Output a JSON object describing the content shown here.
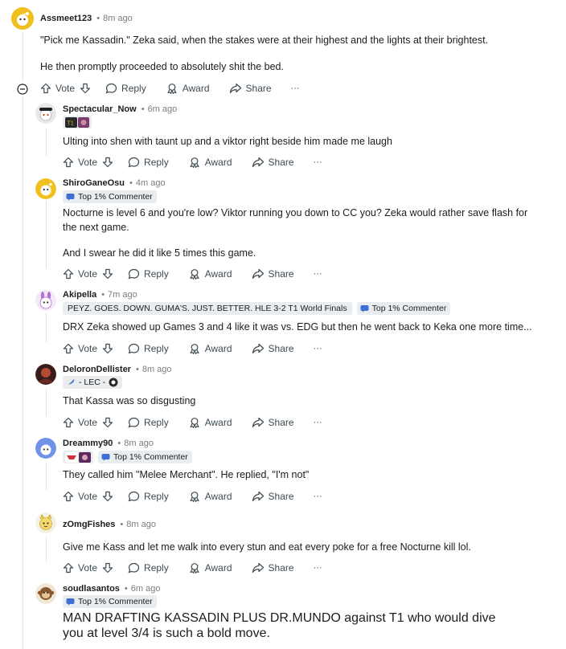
{
  "actions": {
    "vote": "Vote",
    "reply": "Reply",
    "award": "Award",
    "share": "Share",
    "more": "···"
  },
  "colors": {
    "accent_yellow": "#f2c01e",
    "text": "#1c1c1c",
    "muted": "#7c7c7c",
    "flair_bg": "#eaedef"
  },
  "comments": [
    {
      "author": "Assmeet123",
      "time": "8m ago",
      "avatar": "snoo-yellow",
      "paragraphs": [
        "\"Pick me Kassadin.\" Zeka said, when the stakes were at their highest and the lights at their brightest.",
        "He then promptly proceeded to absolutely shit the bed."
      ]
    },
    {
      "author": "Spectacular_Now",
      "time": "6m ago",
      "avatar": "snoo-dark",
      "flair_icons": [
        "team-logo-icon",
        "champion-icon"
      ],
      "paragraphs": [
        "Ulting into shen with taunt up and a viktor right beside him made me laugh"
      ]
    },
    {
      "author": "ShiroGaneOsu",
      "time": "4m ago",
      "avatar": "snoo-yellow",
      "flair": "Top 1% Commenter",
      "paragraphs": [
        "Nocturne is level 6 and you're low? Viktor running you down to CC you? Zeka would rather save flash for",
        "the next game.",
        "And I swear he did it like 5 times this game."
      ]
    },
    {
      "author": "Akipella",
      "time": "7m ago",
      "avatar": "snoo-purple",
      "flair_long": "PEYZ. GOES. DOWN. GUMA'S. JUST. BETTER. HLE 3-2 T1 World Finals",
      "flair": "Top 1% Commenter",
      "paragraphs": [
        "DRX Zeka showed up Games 3 and 4 like it was vs. EDG but then he went back to Keka one more time..."
      ]
    },
    {
      "author": "DeloronDellister",
      "time": "8m ago",
      "avatar": "snoo-red",
      "flair_lec": "- LEC -",
      "paragraphs": [
        "That Kassa was so disgusting"
      ]
    },
    {
      "author": "Dreammy90",
      "time": "8m ago",
      "avatar": "snoo-blue",
      "flair": "Top 1% Commenter",
      "paragraphs": [
        "They called him \"Melee Merchant\". He replied, \"I'm not\""
      ]
    },
    {
      "author": "zOmgFishes",
      "time": "8m ago",
      "avatar": "snoo-cat",
      "paragraphs": [
        "Give me Kass and let me walk into every stun and eat every poke for a free Nocturne kill lol."
      ]
    },
    {
      "author": "soudlasantos",
      "time": "6m ago",
      "avatar": "snoo-monkey",
      "flair": "Top 1% Commenter",
      "paragraphs": [
        "MAN DRAFTING KASSADIN PLUS DR.MUNDO against T1 who would dive",
        "you at level 3/4 is such a bold move."
      ]
    }
  ]
}
